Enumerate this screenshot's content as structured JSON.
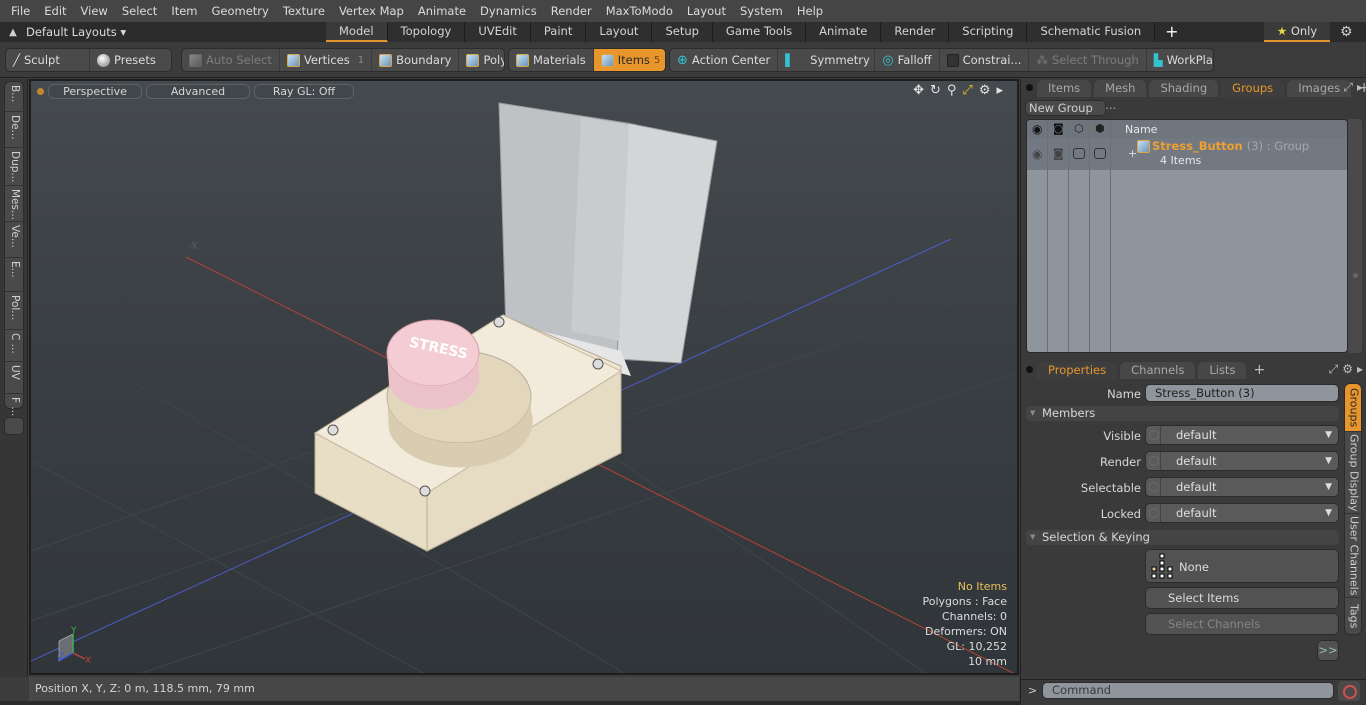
{
  "menu": [
    "File",
    "Edit",
    "View",
    "Select",
    "Item",
    "Geometry",
    "Texture",
    "Vertex Map",
    "Animate",
    "Dynamics",
    "Render",
    "MaxToModo",
    "Layout",
    "System",
    "Help"
  ],
  "layout_bar": {
    "layouts_label": "Default Layouts ▾",
    "tabs": [
      "Model",
      "Topology",
      "UVEdit",
      "Paint",
      "Layout",
      "Setup",
      "Game Tools",
      "Animate",
      "Render",
      "Scripting",
      "Schematic Fusion"
    ],
    "active_tab": "Model",
    "add_tab": "+",
    "only_label": "Only",
    "only_icon": "★"
  },
  "toolbar": {
    "sculpt": "Sculpt",
    "presets": "Presets",
    "auto_select": "Auto Select",
    "vertices": "Vertices",
    "vertices_count": "1",
    "boundary": "Boundary",
    "polygons": "Polygons",
    "materials": "Materials",
    "items": "Items",
    "items_count": "5",
    "action_center": "Action Center",
    "symmetry": "Symmetry",
    "falloff": "Falloff",
    "constraints": "Constrai...",
    "select_through": "Select Through",
    "workplane": "WorkPlane"
  },
  "left_tabs": [
    "B...",
    "De...",
    "Dup...",
    "Mes...",
    "Ve...",
    "E...",
    "Pol...",
    "C ...",
    "UV",
    "F ..."
  ],
  "viewport": {
    "view_mode": "Perspective",
    "shading": "Advanced",
    "raygl": "Ray GL: Off",
    "axis_x_label": "X",
    "axis_y_label": "Y",
    "axis_z_label": "Z",
    "stats": {
      "selection": "No Items",
      "polygons": "Polygons : Face",
      "channels": "Channels: 0",
      "deformers": "Deformers: ON",
      "gl": "GL: 10,252",
      "grid": "10 mm"
    },
    "model_label": "STRESS",
    "colors": {
      "x_axis": "#c0433a",
      "z_axis": "#4a5ec8",
      "accent": "#e8962c"
    }
  },
  "statusbar": {
    "position": "Position X, Y, Z:   0 m, 118.5 mm, 79 mm"
  },
  "groups_panel": {
    "tabs": [
      "Items",
      "Mesh ...",
      "Shading",
      "Groups",
      "Images"
    ],
    "active_tab": "Groups",
    "new_group": "New Group",
    "column_name": "Name",
    "group": {
      "name": "Stress_Button",
      "suffix": "(3) : Group",
      "count": "4 Items"
    }
  },
  "properties_panel": {
    "tabs": [
      "Properties",
      "Channels",
      "Lists"
    ],
    "active_tab": "Properties",
    "name_label": "Name",
    "name_value": "Stress_Button (3)",
    "members_section": "Members",
    "members": [
      {
        "label": "Visible",
        "value": "default"
      },
      {
        "label": "Render",
        "value": "default"
      },
      {
        "label": "Selectable",
        "value": "default"
      },
      {
        "label": "Locked",
        "value": "default"
      }
    ],
    "selection_section": "Selection & Keying",
    "keying_value": "None",
    "select_items": "Select Items",
    "select_channels": "Select Channels",
    "more": ">>",
    "side_tabs": [
      "Groups",
      "Group Display",
      "User Channels",
      "Tags"
    ],
    "active_side_tab": "Groups"
  },
  "command": {
    "prompt": ">",
    "placeholder": "Command"
  }
}
